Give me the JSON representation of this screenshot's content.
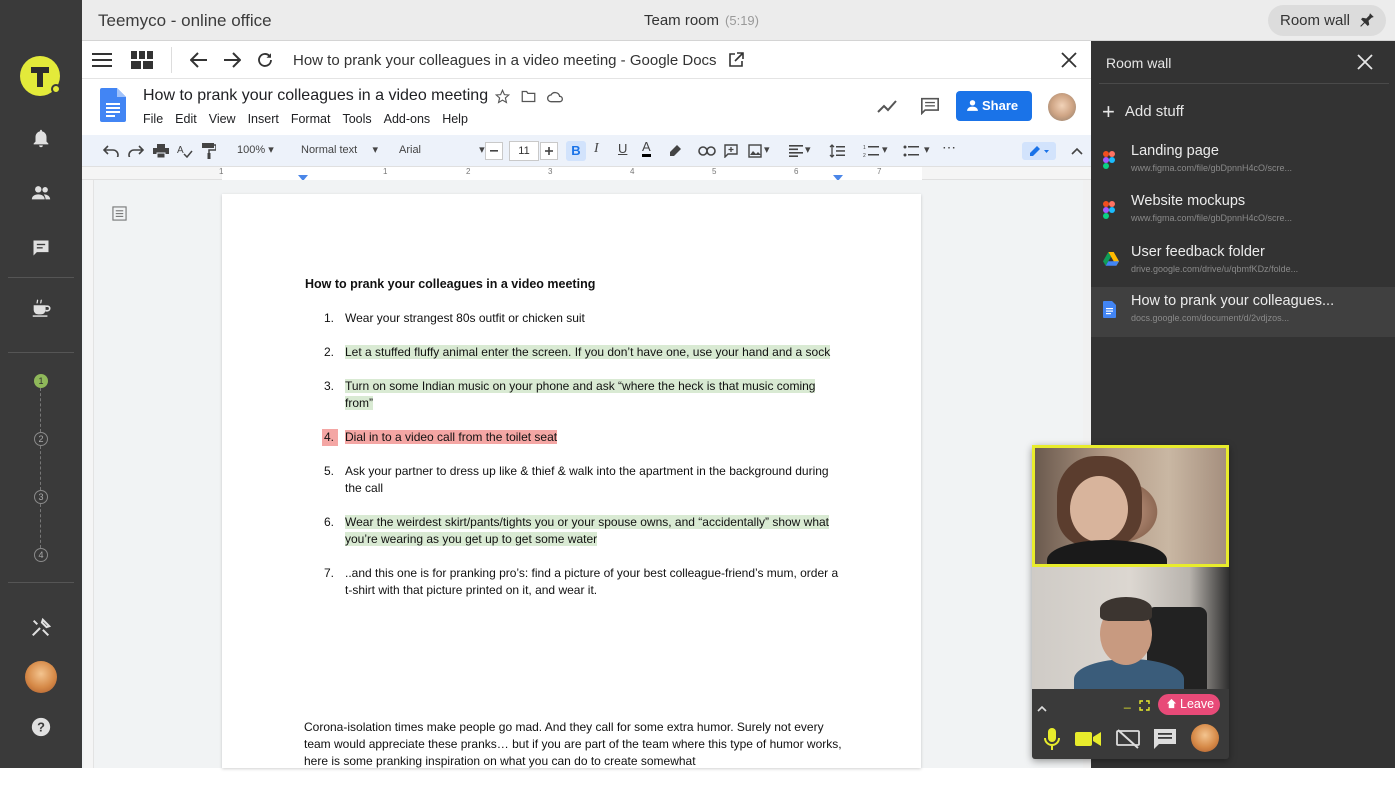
{
  "window": {
    "app_title": "Teemyco - online office",
    "room_title": "Team room",
    "room_timer": "(5:19)",
    "room_wall_button": "Room wall"
  },
  "sidebar": {
    "steps": [
      "1",
      "2",
      "3",
      "4"
    ],
    "active_step": 1
  },
  "browser": {
    "url_title": "How to prank your colleagues in a video meeting - Google Docs"
  },
  "docs": {
    "title": "How to prank your colleagues in a video meeting",
    "menu": [
      "File",
      "Edit",
      "View",
      "Insert",
      "Format",
      "Tools",
      "Add-ons",
      "Help"
    ],
    "share_label": "Share",
    "zoom": "100%",
    "style": "Normal text",
    "font": "Arial",
    "font_size": "11",
    "bold_label": "B",
    "italic_label": "I",
    "underline_label": "U",
    "color_label": "A",
    "ruler_numbers": [
      "1",
      "1",
      "2",
      "3",
      "4",
      "5",
      "6",
      "7"
    ]
  },
  "document": {
    "heading": "How to prank your colleagues in a video meeting",
    "items": [
      {
        "num": "1.",
        "text": "Wear your strangest 80s outfit or chicken suit",
        "highlight": "none"
      },
      {
        "num": "2.",
        "text": "Let a stuffed fluffy animal enter the screen. If you don’t have one, use your hand and a sock",
        "highlight": "green"
      },
      {
        "num": "3.",
        "text": "Turn on some Indian music on your phone and ask “where the heck is that music coming from”",
        "highlight": "green"
      },
      {
        "num": "4.",
        "text": "Dial in to a video call from the toilet seat",
        "highlight": "red"
      },
      {
        "num": "5.",
        "text": "Ask your partner to dress up like & thief & walk into the apartment in the background during the call",
        "highlight": "none"
      },
      {
        "num": "6.",
        "text": "Wear the weirdest skirt/pants/tights you or your spouse owns, and “accidentally” show what you’re wearing as you get up to get some water",
        "highlight": "green"
      },
      {
        "num": "7.",
        "text": "..and this one is for pranking pro’s: find a picture of your best colleague-friend’s mum, order a t-shirt with that picture printed on it, and wear it.",
        "highlight": "none"
      }
    ],
    "paragraph": "Corona-isolation times make people go mad. And they call for some extra humor. Surely not every team would appreciate these pranks… but if you are part of the team where this type of humor works, here is some pranking inspiration on what you can do to create somewhat"
  },
  "room_wall": {
    "title": "Room wall",
    "add_label": "Add stuff",
    "items": [
      {
        "name": "Landing page",
        "url": "www.figma.com/file/gbDpnnH4cO/scre...",
        "icon": "figma-icon"
      },
      {
        "name": "Website mockups",
        "url": "www.figma.com/file/gbDpnnH4cO/scre...",
        "icon": "figma-icon"
      },
      {
        "name": "User feedback folder",
        "url": "drive.google.com/drive/u/qbmfKDz/folde...",
        "icon": "google-drive-icon"
      },
      {
        "name": "How to prank your colleagues...",
        "url": "docs.google.com/document/d/2vdjzos...",
        "icon": "google-docs-icon"
      }
    ]
  },
  "video": {
    "leave_label": "Leave"
  },
  "colors": {
    "accent_yellow": "#e8ec2c",
    "leave_pink": "#e84a78",
    "share_blue": "#1a73e8",
    "highlight_green": "#d9ead3",
    "highlight_red": "#f4a6a4"
  }
}
